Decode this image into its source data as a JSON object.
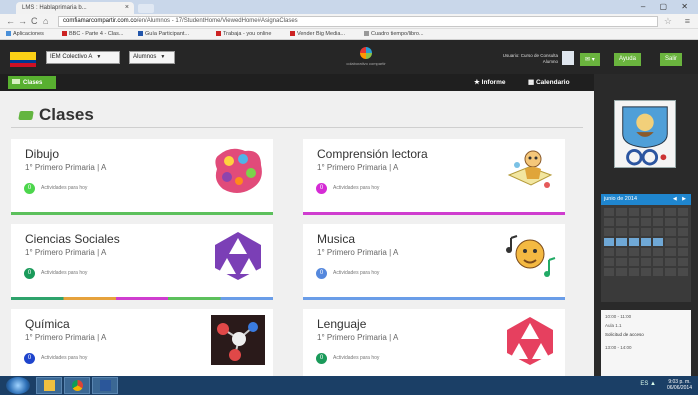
{
  "browser": {
    "tab_title": "LMS : Hablaprimaria b...",
    "tab_close": "×",
    "url_host": "comfiamarcompartir.com.co",
    "url_rest": "/en/Alumnos - 17/StudentHome/ViewedHome#AsignaClases",
    "window_controls": "– ▢ ✕",
    "back": "←",
    "forward": "→",
    "reload": "C",
    "home": "⌂",
    "bookmark_star": "☆",
    "menu": "≡",
    "bookmarks": [
      "Aplicaciones",
      "BBC - Parte 4 - Clas...",
      "Guía Participant...",
      "Trabaja - you online",
      "Vender Big Media...",
      "Cuadro tiempo/libro..."
    ]
  },
  "header": {
    "school_select": "IEM Colectivo A",
    "role_select": "Alumnos",
    "logo_text": "colaborativo compartir",
    "user_line1": "Usuario: Curso de Consulta",
    "user_line2": "Alumno",
    "btn_messages": "✉ ▾",
    "btn_help": "Ayuda",
    "btn_exit": "Salir"
  },
  "nav": {
    "classes": "Clases",
    "report": "★ Informe",
    "calendar": "▦ Calendario"
  },
  "main": {
    "title": "Clases",
    "cards": [
      {
        "name": "Dibujo",
        "sub": "1° Primero Primaria | A",
        "badge": "0",
        "activity": "Actividades para hoy",
        "badge_color": "#4cd64c",
        "bar_color": "#5cc05c"
      },
      {
        "name": "Comprensión lectora",
        "sub": "1° Primero Primaria | A",
        "badge": "0",
        "activity": "Actividades para hoy",
        "badge_color": "#d52bd5",
        "bar_color": "#cf3dcf"
      },
      {
        "name": "Ciencias Sociales",
        "sub": "1° Primero Primaria | A",
        "badge": "0",
        "activity": "Actividades para hoy",
        "badge_color": "#1a9a5a",
        "bar_color": "#2fa36c"
      },
      {
        "name": "Musica",
        "sub": "1° Primero Primaria | A",
        "badge": "0",
        "activity": "Actividades para hoy",
        "badge_color": "#5588dd",
        "bar_color": "#6a9de8"
      },
      {
        "name": "Química",
        "sub": "1° Primero Primaria | A",
        "badge": "0",
        "activity": "Actividades para hoy",
        "badge_color": "#1e44cc",
        "bar_color": "#2b55d4"
      },
      {
        "name": "Lenguaje",
        "sub": "1° Primero Primaria | A",
        "badge": "0",
        "activity": "Actividades para hoy",
        "badge_color": "#1a9a5a",
        "bar_color": "#e04f6c"
      }
    ]
  },
  "sidebar": {
    "calendar_title": "junio de 2014",
    "calendar_nav": "◀ ▶",
    "notes": [
      "10:00 - 11:00",
      "Aula 1.1",
      "Solicitud de acceso",
      "13:00 - 14:00"
    ]
  },
  "taskbar": {
    "tray": "ES ▲",
    "clock_time": "9:03 p. m.",
    "clock_date": "06/06/2014"
  },
  "colors": {
    "accent_green": "#6ab43e",
    "header_dark": "#262626",
    "calendar_blue": "#1f86cf"
  }
}
